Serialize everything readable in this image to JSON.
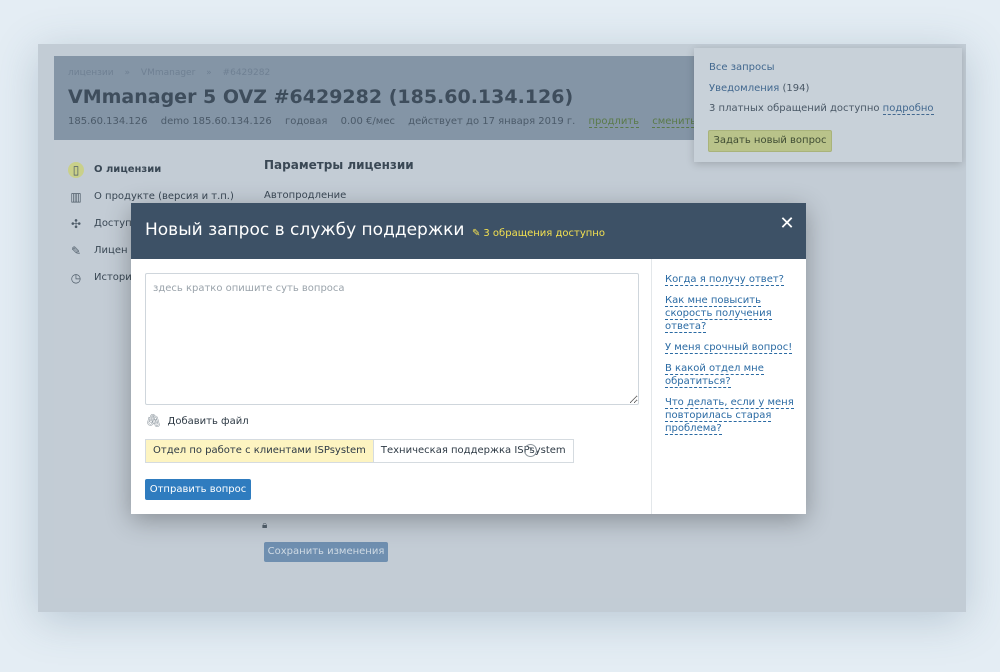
{
  "app": {
    "breadcrumbs": [
      "лицензии",
      "»",
      "VMmanager",
      "»",
      "#6429282"
    ],
    "title": "VMmanager 5 OVZ #6429282 (185.60.134.126)",
    "meta": {
      "ip": "185.60.134.126",
      "demo": "demo 185.60.134.126",
      "period": "годовая",
      "price": "0.00 €/мес",
      "valid_until": "действует до 17 января 2019 г.",
      "extend_link": "продлить",
      "change_tariff_link": "сменить тариф"
    },
    "sidebar": [
      {
        "label": "О лицензии",
        "icon": "license-icon",
        "active": true
      },
      {
        "label": "О продукте (версия и т.п.)",
        "icon": "barcode-icon",
        "active": false
      },
      {
        "label": "Доступ",
        "icon": "puzzle-icon",
        "active": false
      },
      {
        "label": "Лицен",
        "icon": "document-icon",
        "active": false
      },
      {
        "label": "Истори",
        "icon": "clock-icon",
        "active": false
      }
    ],
    "section_title": "Параметры лицензии",
    "auto_renew_label": "Автопродление",
    "save_button": "Сохранить изменения"
  },
  "dropdown": {
    "all_requests": "Все запросы",
    "notifications": "Уведомления",
    "notifications_count": "(194)",
    "paid_text": "3 платных обращений доступно",
    "paid_link": "подробно",
    "new_question_button": "Задать новый вопрос"
  },
  "modal": {
    "title": "Новый запрос в службу поддержки",
    "badge": "3 обращения доступно",
    "placeholder": "здесь кратко опишите суть вопроса",
    "attach_label": "Добавить файл",
    "departments": [
      {
        "label": "Отдел по работе с клиентами ISPsystem",
        "selected": true
      },
      {
        "label": "Техническая поддержка ISPsystem",
        "selected": false
      }
    ],
    "help_mark": "?",
    "submit_button": "Отправить вопрос",
    "faq": [
      "Когда я получу ответ?",
      "Как мне повысить скорость получения ответа?",
      "У меня срочный вопрос!",
      "В какой отдел мне обратиться?",
      "Что делать, если у меня повторилась старая проблема?"
    ]
  },
  "colors": {
    "modal_header": "#3d5166",
    "badge": "#f4e150",
    "primary_button": "#2f7cbf",
    "link": "#2a6aa3",
    "selected_segment": "#fdf4c1"
  }
}
